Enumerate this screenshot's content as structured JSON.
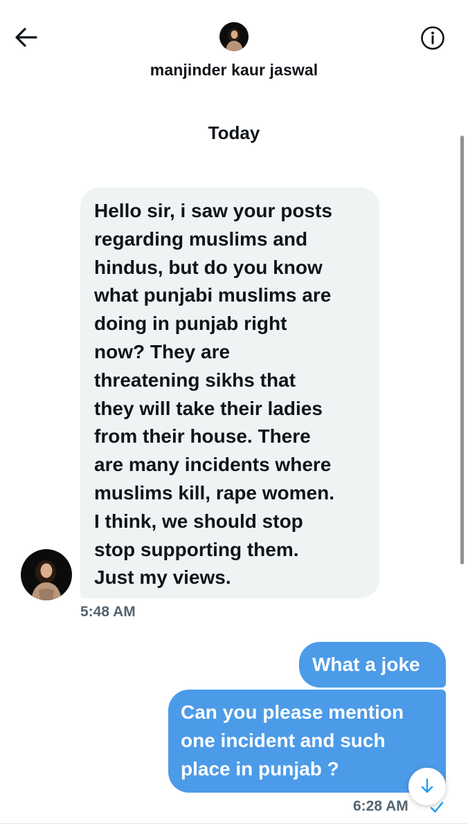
{
  "header": {
    "back_icon": "arrow-left-icon",
    "contact_name": "manjinder kaur jaswal",
    "info_icon": "info-circle-icon"
  },
  "conversation": {
    "date_separator": "Today",
    "incoming": {
      "text": "Hello sir, i saw your posts\nregarding muslims and\nhindus, but do you know\nwhat punjabi muslims are\ndoing in punjab right\nnow? They are\nthreatening sikhs that\nthey will take their ladies\nfrom their house. There\nare many incidents where\nmuslims kill, rape women.\nI think, we should stop\nstop supporting them.\nJust my views.",
      "time": "5:48 AM"
    },
    "outgoing": [
      {
        "text": "What a joke"
      },
      {
        "text": "Can you please mention\none incident and such\nplace in punjab ?"
      }
    ],
    "outgoing_time": "6:28 AM",
    "read_icon": "checkmark-icon",
    "scroll_down_icon": "arrow-down-icon"
  },
  "colors": {
    "accent": "#1d9bf0",
    "outgoing_bubble": "#4c9be8",
    "incoming_bubble": "#eff3f4",
    "text": "#0f1419",
    "muted": "#536471"
  }
}
